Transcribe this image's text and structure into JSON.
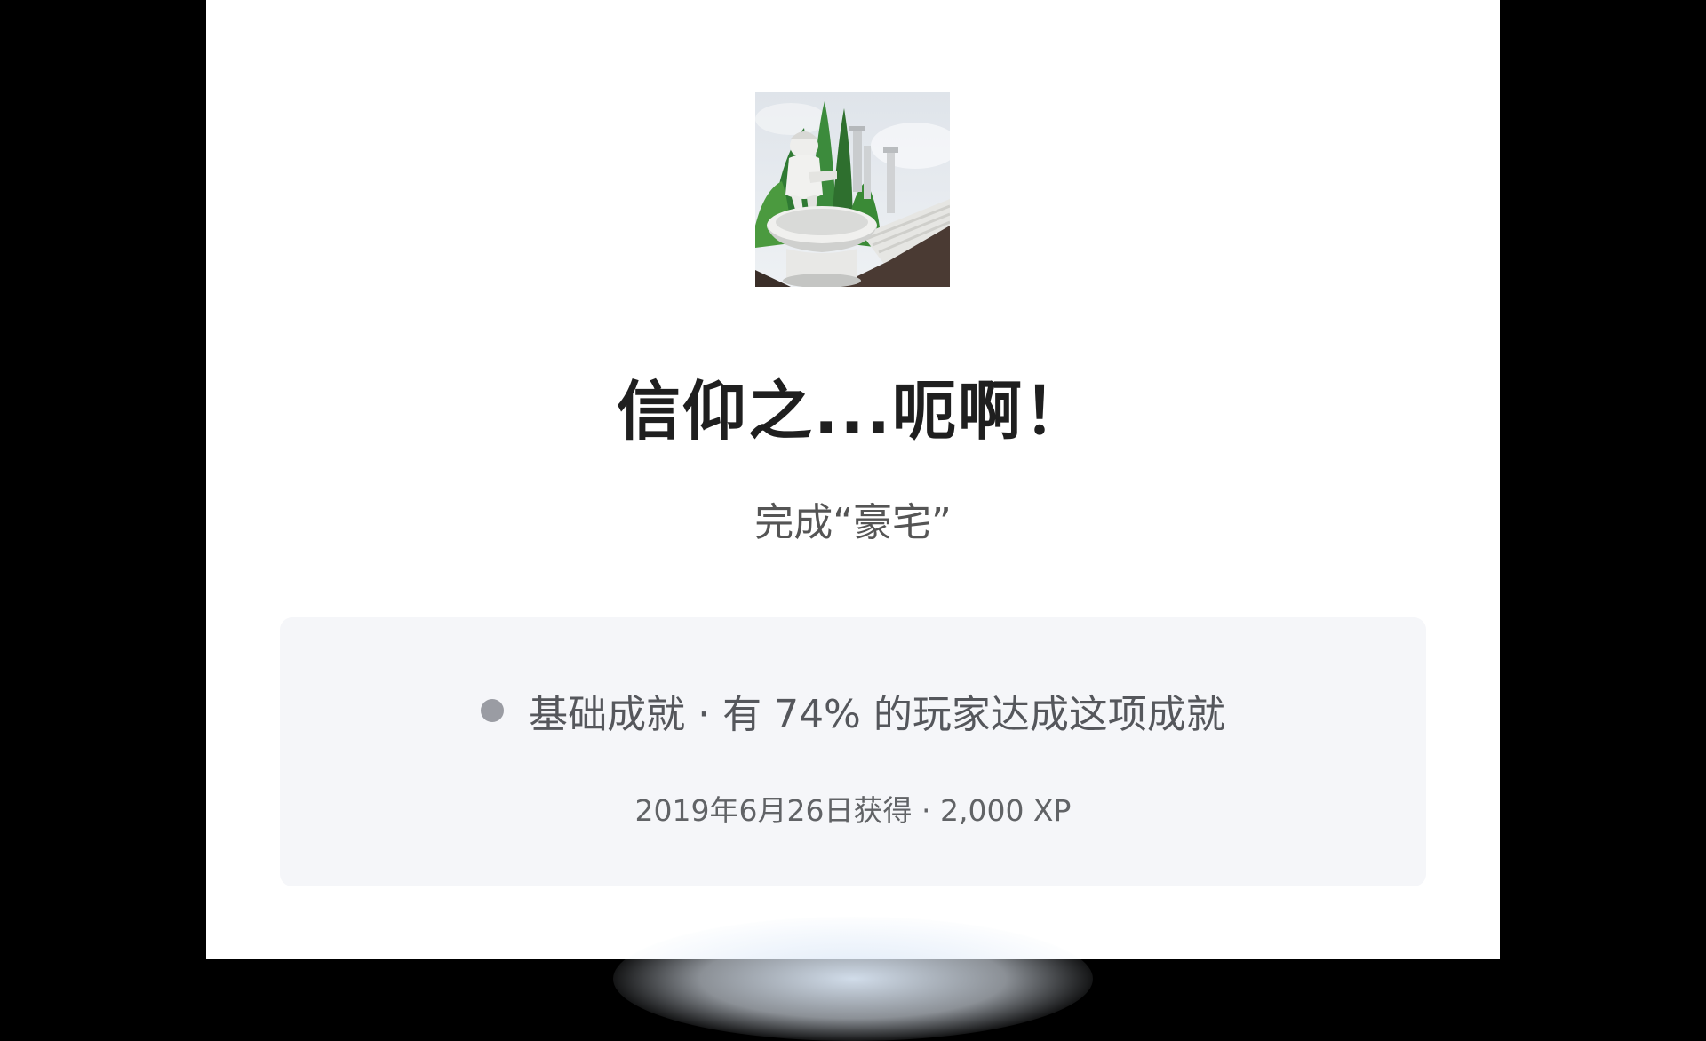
{
  "achievement": {
    "icon_name": "fountain-statue-artwork",
    "title": "信仰之...呃啊！",
    "description": "完成“豪宅”",
    "rarity_text": "基础成就 · 有 74% 的玩家达成这项成就",
    "earned_text": "2019年6月26日获得 · 2,000 XP"
  },
  "colors": {
    "panel_background": "#ffffff",
    "outer_background": "#000000",
    "card_background": "#f5f6f9",
    "rarity_dot": "#9a9ca3"
  }
}
